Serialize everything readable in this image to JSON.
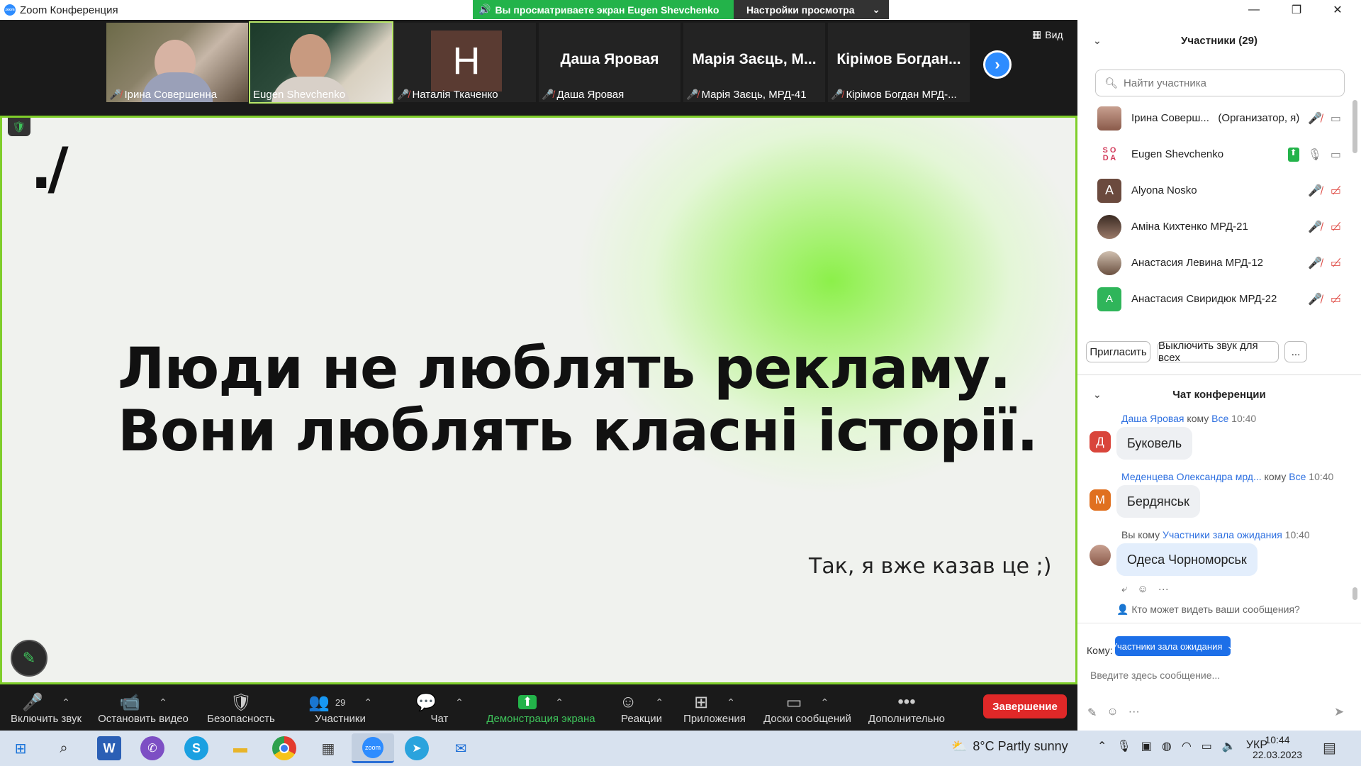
{
  "window": {
    "title": "Zoom Конференция",
    "controls": [
      "—",
      "❐",
      "✕"
    ]
  },
  "share_banner": {
    "text": "Вы просматриваете экран Eugen Shevchenko",
    "settings": "Настройки просмотра"
  },
  "strip": {
    "tiles": [
      {
        "name": "Ірина Совершенна",
        "type": "video"
      },
      {
        "name": "Eugen Shevchenko",
        "type": "video",
        "active": true
      },
      {
        "name": "Наталія Ткаченко",
        "initial": "H",
        "type": "initial"
      },
      {
        "name": "Даша Яровая",
        "display": "Даша Яровая",
        "type": "name"
      },
      {
        "name": "Марія Заєць, МРД-41",
        "display": "Марія Заєць, М...",
        "type": "name"
      },
      {
        "name": "Кірімов Богдан МРД-...",
        "display": "Кірімов Богдан...",
        "type": "name"
      }
    ],
    "view_label": "Вид"
  },
  "share": {
    "logo": "./",
    "headline_1": "Люди не люблять рекламу.",
    "headline_2": "Вони люблять класні історії.",
    "subtitle": "Так, я вже казав це ;)"
  },
  "toolbar": {
    "items": [
      {
        "label": "Включить звук",
        "icon": "mic-muted-icon"
      },
      {
        "label": "Остановить видео",
        "icon": "camera-icon"
      },
      {
        "label": "Безопасность",
        "icon": "shield-icon"
      },
      {
        "label": "Участники",
        "icon": "participants-icon",
        "count": "29"
      },
      {
        "label": "Чат",
        "icon": "chat-icon"
      },
      {
        "label": "Демонстрация экрана",
        "icon": "share-screen-icon"
      },
      {
        "label": "Реакции",
        "icon": "reaction-icon"
      },
      {
        "label": "Приложения",
        "icon": "apps-icon"
      },
      {
        "label": "Доски сообщений",
        "icon": "whiteboard-icon"
      },
      {
        "label": "Дополнительно",
        "icon": "more-icon"
      }
    ],
    "end_label": "Завершение"
  },
  "participants": {
    "title": "Участники (29)",
    "search_placeholder": "Найти участника",
    "list": [
      {
        "name": "Ірина Соверш...",
        "role": "(Организатор, я)",
        "avatar": "photo",
        "color": "#a86a5a"
      },
      {
        "name": "Eugen Shevchenko",
        "avatar": "SODA",
        "color": "#ffffff"
      },
      {
        "name": "Alyona Nosko",
        "avatar": "A",
        "color": "#6b4a3e"
      },
      {
        "name": "Аміна Кихтенко МРД-21",
        "avatar": "photo",
        "color": "#5a3b2e"
      },
      {
        "name": "Анастасия Левина МРД-12",
        "avatar": "photo",
        "color": "#8a7060"
      },
      {
        "name": "Анастасия Свиридюк МРД-22",
        "avatar": "A",
        "color": "#2fb55a"
      }
    ],
    "invite_label": "Пригласить",
    "mute_all_label": "Выключить звук для всех",
    "more_label": "..."
  },
  "chat": {
    "title": "Чат конференции",
    "messages": [
      {
        "sender": "Даша Яровая",
        "to_word": "кому",
        "to": "Все",
        "time": "10:40",
        "text": "Буковель",
        "initial": "Д",
        "color": "#d9453b"
      },
      {
        "sender": "Меденцева Олександра мрд...",
        "to_word": "кому",
        "to": "Все",
        "time": "10:40",
        "text": "Бердянськ",
        "initial": "М",
        "color": "#e0701f"
      },
      {
        "sender": "Вы",
        "to_word": "кому",
        "to": "Участники зала ожидания",
        "time": "10:40",
        "text": "Одеса Чорноморськ",
        "initial": "",
        "color": "#a86a5a"
      }
    ],
    "who_sees": "Кто может видеть ваши сообщения?",
    "to_label": "Кому:",
    "to_value": "Участники зала ожидания",
    "input_placeholder": "Введите здесь сообщение..."
  },
  "taskbar": {
    "weather": "8°C  Partly sunny",
    "lang": "УКР",
    "time": "10:44",
    "date": "22.03.2023"
  }
}
